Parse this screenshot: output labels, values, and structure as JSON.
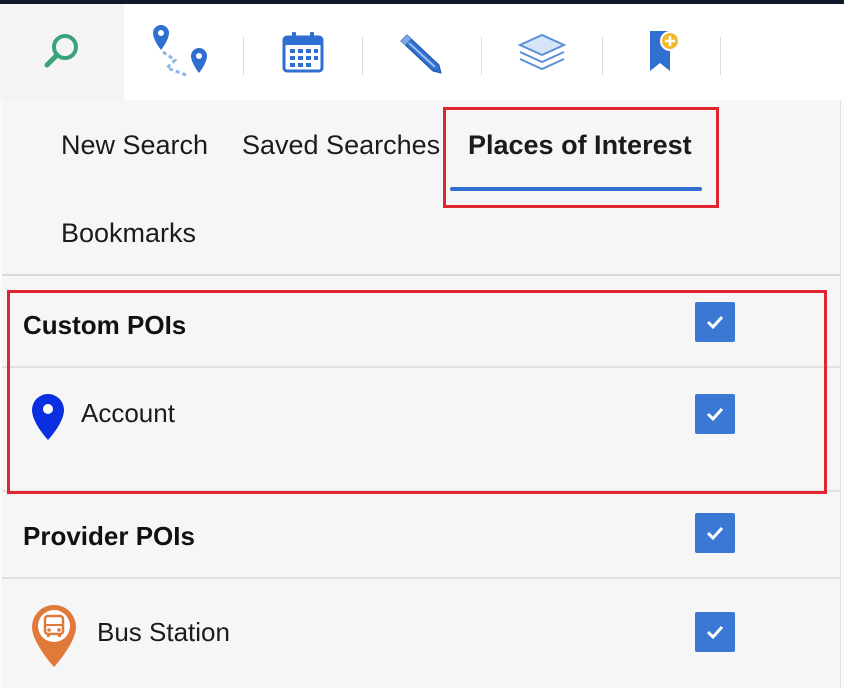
{
  "toolbar": {
    "tools": [
      {
        "icon": "search-icon",
        "active": true
      },
      {
        "icon": "route-icon"
      },
      {
        "icon": "calendar-icon"
      },
      {
        "icon": "pencil-icon"
      },
      {
        "icon": "layers-icon"
      },
      {
        "icon": "bookmark-add-icon"
      }
    ]
  },
  "tabs": {
    "new_search": "New Search",
    "saved_searches": "Saved Searches",
    "places_of_interest": "Places of Interest",
    "bookmarks": "Bookmarks",
    "active": "places_of_interest"
  },
  "custom_pois": {
    "title": "Custom POIs",
    "checked": true,
    "items": [
      {
        "label": "Account",
        "icon": "map-pin-icon",
        "checked": true
      }
    ]
  },
  "provider_pois": {
    "title": "Provider POIs",
    "checked": true,
    "items": [
      {
        "label": "Bus Station",
        "icon": "bus-station-icon",
        "checked": true
      }
    ]
  },
  "colors": {
    "accent": "#3a78d4",
    "highlight": "#e0262e",
    "search_icon": "#3aa37a",
    "pin": "#0a2fe0",
    "bus_pin": "#e07a3a"
  }
}
